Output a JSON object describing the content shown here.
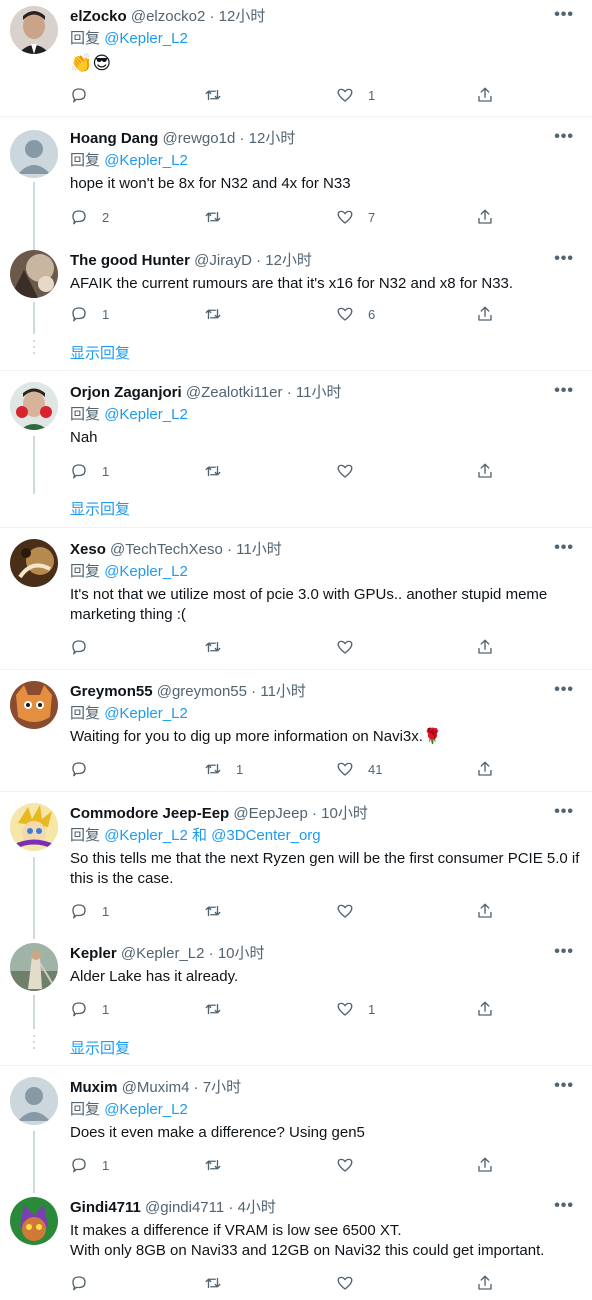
{
  "labels": {
    "reply_prefix": "回复",
    "and": "和",
    "show_replies": "显示回复",
    "dot": "·",
    "more": "•••"
  },
  "tweets": [
    {
      "name": "elZocko",
      "handle": "@elzocko2",
      "time": "12小时",
      "mentions": [
        "@Kepler_L2"
      ],
      "text": "👏😎",
      "counts": {
        "reply": "",
        "retweet": "",
        "like": "1"
      }
    },
    {
      "name": "Hoang Dang",
      "handle": "@rewgo1d",
      "time": "12小时",
      "mentions": [
        "@Kepler_L2"
      ],
      "text": "hope it won't be 8x for N32 and 4x for N33",
      "counts": {
        "reply": "2",
        "retweet": "",
        "like": "7"
      }
    },
    {
      "name": "The good Hunter",
      "handle": "@JirayD",
      "time": "12小时",
      "mentions": [],
      "text": "AFAIK the current rumours are that it's x16 for N32 and x8 for N33.",
      "counts": {
        "reply": "1",
        "retweet": "",
        "like": "6"
      }
    },
    {
      "name": "Orjon Zaganjori",
      "handle": "@Zealotki11er",
      "time": "11小时",
      "mentions": [
        "@Kepler_L2"
      ],
      "text": "Nah",
      "counts": {
        "reply": "1",
        "retweet": "",
        "like": ""
      }
    },
    {
      "name": "Xeso",
      "handle": "@TechTechXeso",
      "time": "11小时",
      "mentions": [
        "@Kepler_L2"
      ],
      "text": "It's not that we utilize most of pcie 3.0 with GPUs.. another stupid meme marketing thing :(",
      "counts": {
        "reply": "",
        "retweet": "",
        "like": ""
      }
    },
    {
      "name": "Greymon55",
      "handle": "@greymon55",
      "time": "11小时",
      "mentions": [
        "@Kepler_L2"
      ],
      "text": "Waiting for you to dig up more information on Navi3x.🌹",
      "counts": {
        "reply": "",
        "retweet": "1",
        "like": "41"
      }
    },
    {
      "name": "Commodore Jeep-Eep",
      "handle": "@EepJeep",
      "time": "10小时",
      "mentions": [
        "@Kepler_L2",
        "@3DCenter_org"
      ],
      "text": "So this tells me that the next Ryzen gen will be the first consumer PCIE 5.0 if this is the case.",
      "counts": {
        "reply": "1",
        "retweet": "",
        "like": ""
      }
    },
    {
      "name": "Kepler",
      "handle": "@Kepler_L2",
      "time": "10小时",
      "mentions": [],
      "text": "Alder Lake has it already.",
      "counts": {
        "reply": "1",
        "retweet": "",
        "like": "1"
      }
    },
    {
      "name": "Muxim",
      "handle": "@Muxim4",
      "time": "7小时",
      "mentions": [
        "@Kepler_L2"
      ],
      "text": "Does it even make a difference? Using gen5",
      "counts": {
        "reply": "1",
        "retweet": "",
        "like": ""
      }
    },
    {
      "name": "Gindi4711",
      "handle": "@gindi4711",
      "time": "4小时",
      "mentions": [],
      "text": "It makes a difference if VRAM is low see 6500 XT.\nWith only 8GB on Navi33 and 12GB on Navi32 this could get important.",
      "counts": {
        "reply": "",
        "retweet": "",
        "like": ""
      }
    }
  ],
  "colors": {
    "link": "#1d9bf0",
    "secondary": "#536471",
    "divider": "#eff3f4",
    "thread": "#cfd9de"
  },
  "icons": [
    "reply-icon",
    "retweet-icon",
    "like-icon",
    "share-icon",
    "more-icon"
  ]
}
